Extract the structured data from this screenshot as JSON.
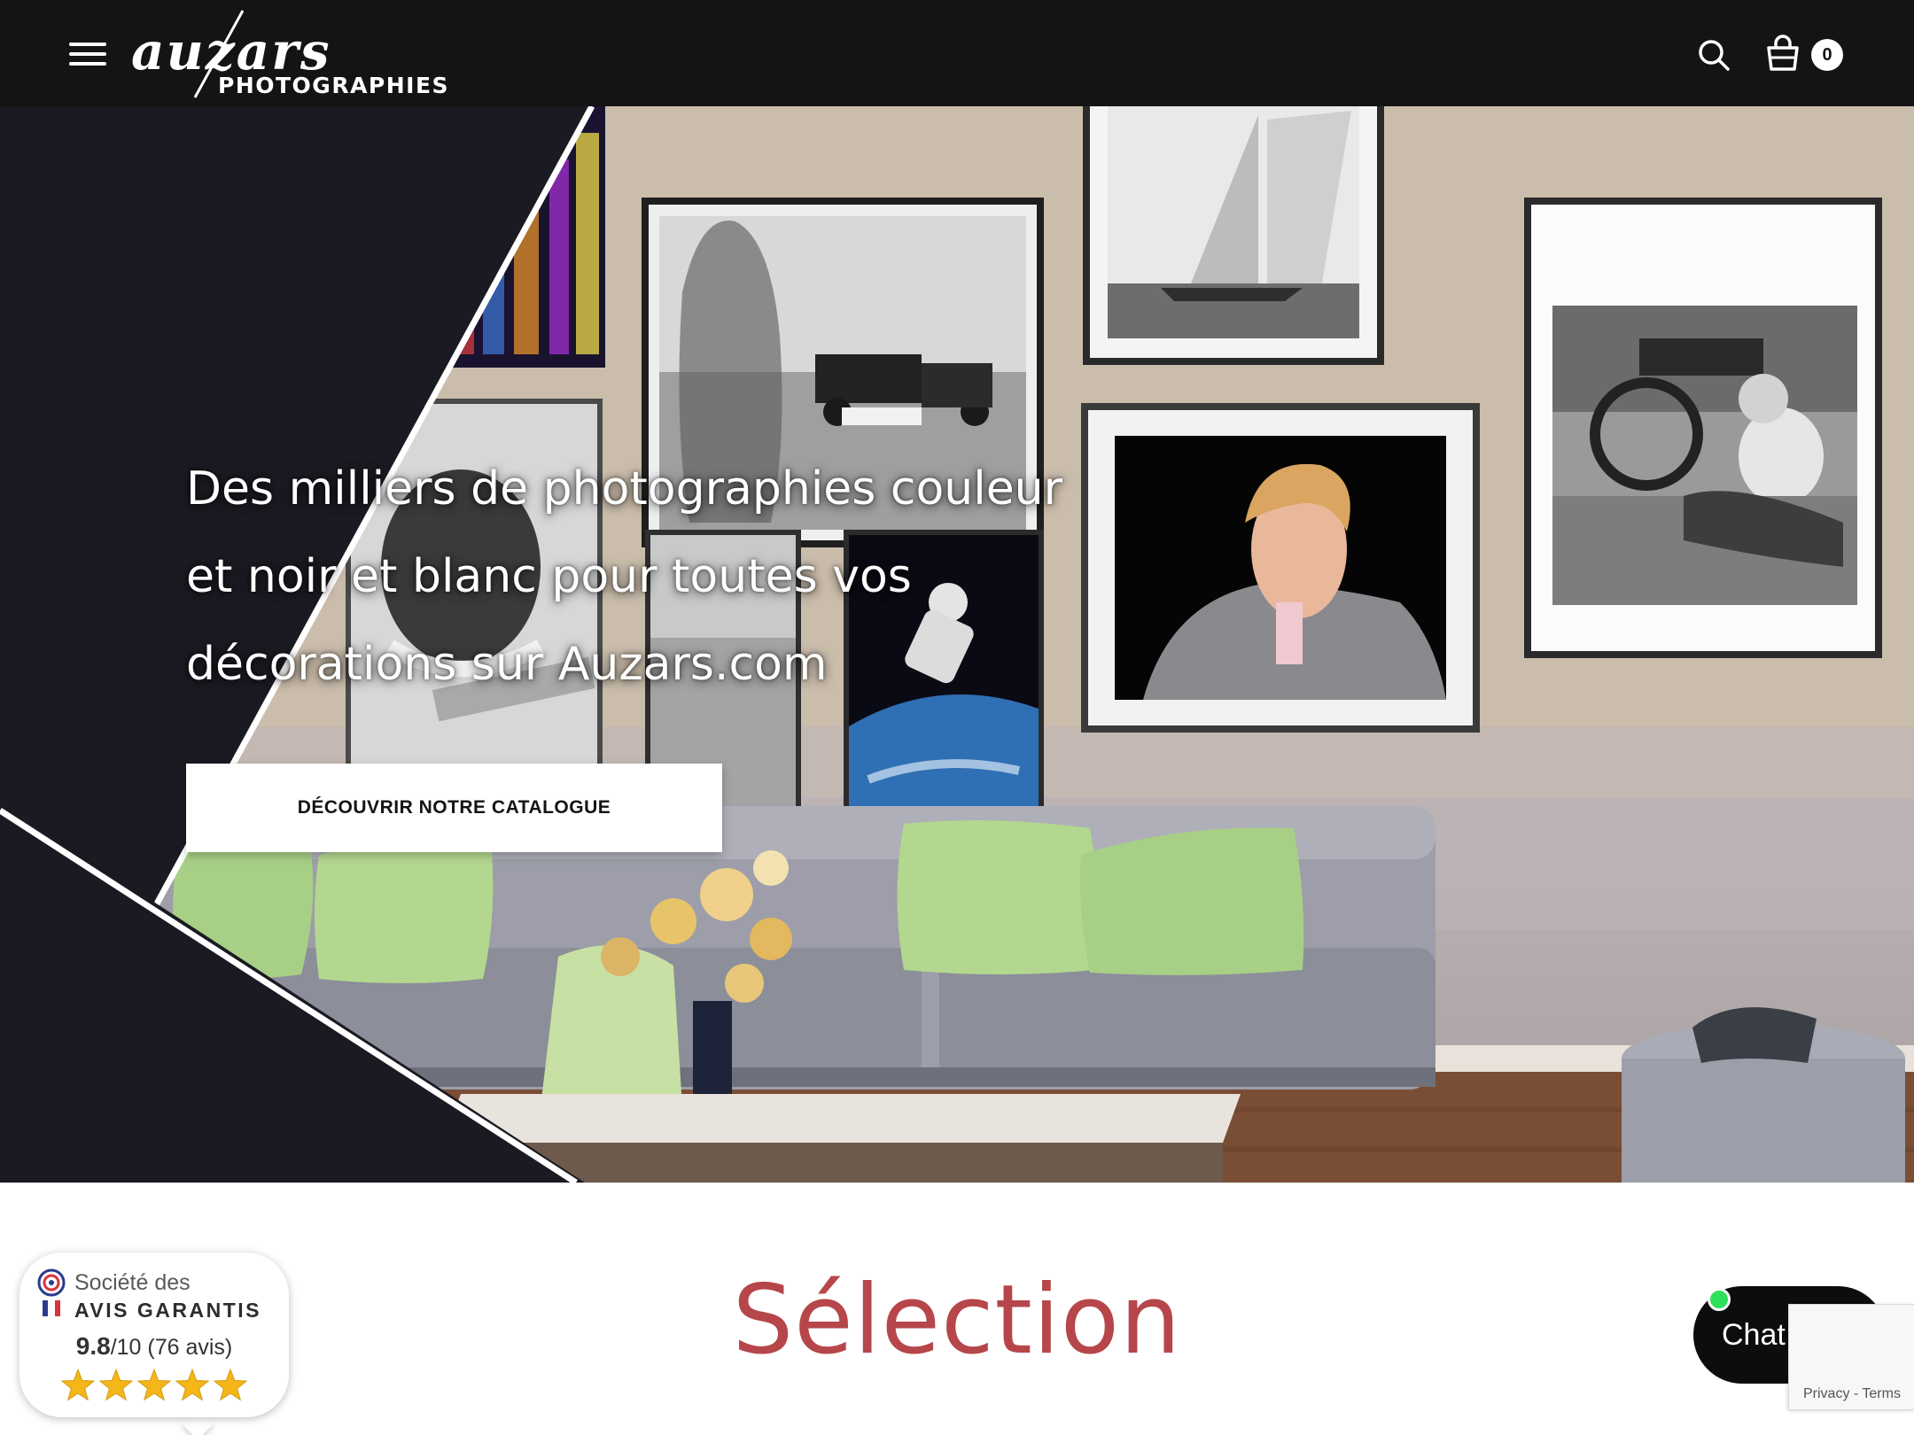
{
  "header": {
    "logo_main": "auzars",
    "logo_sub": "PHOTOGRAPHIES",
    "cart_count": "0"
  },
  "hero": {
    "title": "Des milliers de photographies couleur et noir et blanc pour toutes vos décorations sur Auzars.com",
    "cta_label": "DÉCOUVRIR NOTRE CATALOGUE"
  },
  "section": {
    "title": "Sélection"
  },
  "avis": {
    "line1": "Société des",
    "line2": "AVIS GARANTIS",
    "score": "9.8",
    "score_suffix": "/10 (76 avis)",
    "stars": 5
  },
  "chat": {
    "label": "Chat"
  },
  "recaptcha": {
    "privacy": "Privacy",
    "separator": " - ",
    "terms": "Terms"
  },
  "colors": {
    "header_bg": "#141416",
    "accent_title": "#b6464a",
    "star": "#f5b619",
    "chat_online": "#2ee05a"
  }
}
